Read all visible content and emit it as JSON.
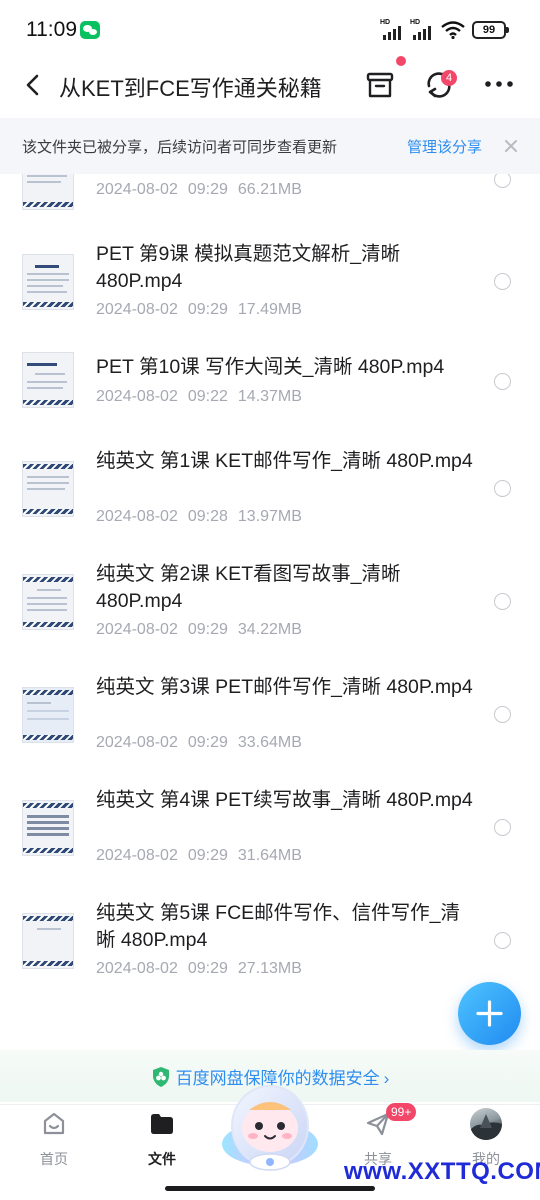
{
  "status_bar": {
    "time": "11:09",
    "network_label": "HD",
    "battery": "99"
  },
  "header": {
    "title": "从KET到FCE写作通关秘籍",
    "sync_badge": "4"
  },
  "share_notice": {
    "text": "该文件夹已被分享，后续访问者可同步查看更新",
    "manage_link": "管理该分享"
  },
  "files": [
    {
      "name": "",
      "date": "2024-08-02",
      "time": "09:29",
      "size": "66.21MB"
    },
    {
      "name": "PET 第9课 模拟真题范文解析_清晰 480P.mp4",
      "date": "2024-08-02",
      "time": "09:29",
      "size": "17.49MB"
    },
    {
      "name": "PET 第10课 写作大闯关_清晰 480P.mp4",
      "date": "2024-08-02",
      "time": "09:22",
      "size": "14.37MB"
    },
    {
      "name": "纯英文 第1课 KET邮件写作_清晰 480P.mp4",
      "date": "2024-08-02",
      "time": "09:28",
      "size": "13.97MB"
    },
    {
      "name": "纯英文 第2课 KET看图写故事_清晰 480P.mp4",
      "date": "2024-08-02",
      "time": "09:29",
      "size": "34.22MB"
    },
    {
      "name": "纯英文 第3课 PET邮件写作_清晰 480P.mp4",
      "date": "2024-08-02",
      "time": "09:29",
      "size": "33.64MB"
    },
    {
      "name": "纯英文 第4课 PET续写故事_清晰 480P.mp4",
      "date": "2024-08-02",
      "time": "09:29",
      "size": "31.64MB"
    },
    {
      "name": "纯英文 第5课 FCE邮件写作、信件写作_清晰 480P.mp4",
      "date": "2024-08-02",
      "time": "09:29",
      "size": "27.13MB"
    }
  ],
  "security_banner": {
    "text": "百度网盘保障你的数据安全",
    "arrow": "›"
  },
  "bottom_nav": {
    "tabs": [
      {
        "label": "首页"
      },
      {
        "label": "文件"
      },
      {
        "label": "共享"
      },
      {
        "label": "我的"
      }
    ],
    "share_badge": "99+"
  },
  "watermark": "www.XXTTQ.COM",
  "colors": {
    "accent": "#2e8ef0",
    "badge": "#f24768",
    "text_primary": "#1f1f22",
    "text_secondary": "#a6a9b2"
  }
}
